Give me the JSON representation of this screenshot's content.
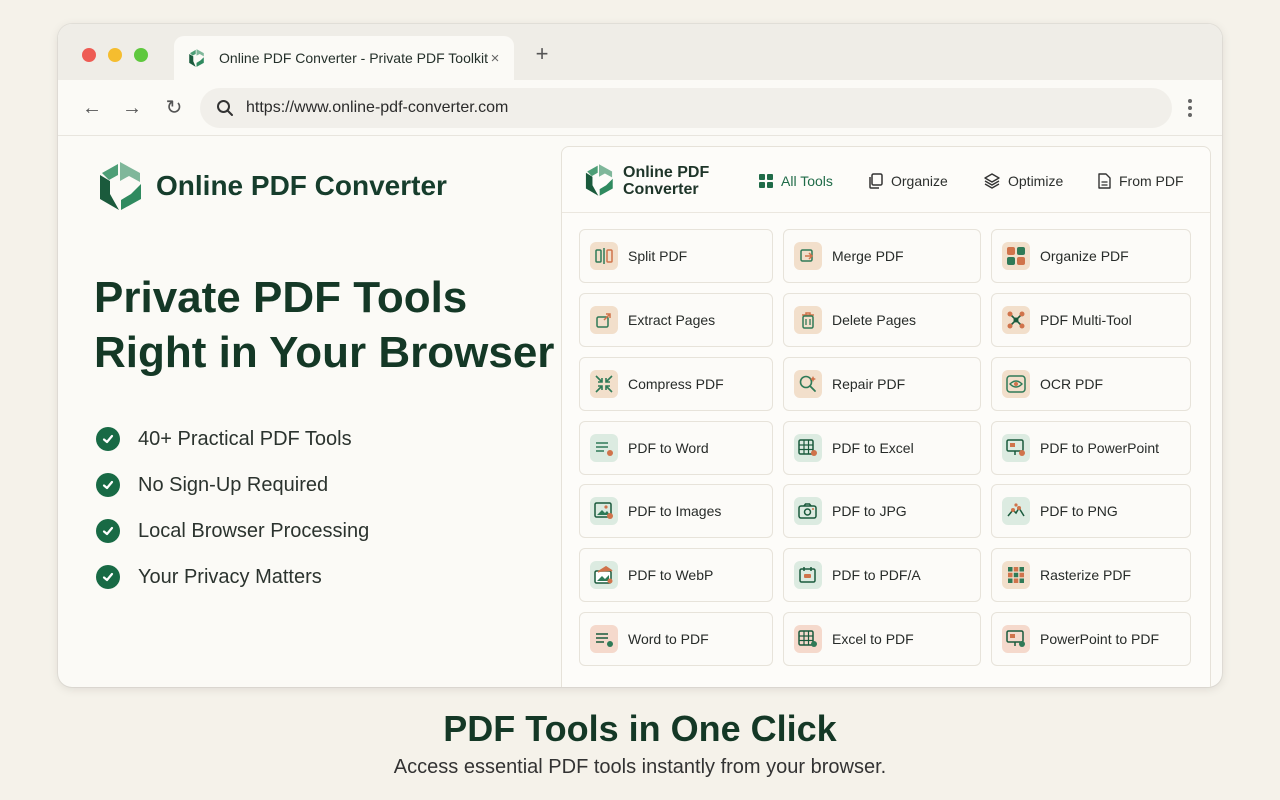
{
  "browser": {
    "tab_title": "Online PDF Converter - Private PDF Toolkit",
    "tab_close": "×",
    "new_tab": "+",
    "url": "https://www.online-pdf-converter.com",
    "back": "←",
    "forward": "→",
    "reload": "↻"
  },
  "hero": {
    "brand": "Online PDF Converter",
    "title_line1": "Private PDF Tools",
    "title_line2": "Right in Your Browser",
    "features": [
      "40+ Practical PDF Tools",
      "No Sign-Up Required",
      "Local Browser Processing",
      "Your Privacy Matters"
    ]
  },
  "panel": {
    "brand_line1": "Online PDF",
    "brand_line2": "Converter",
    "nav": [
      "All Tools",
      "Organize",
      "Optimize",
      "From PDF"
    ],
    "tools": [
      {
        "label": "Split PDF",
        "icon": "split-icon"
      },
      {
        "label": "Merge PDF",
        "icon": "merge-icon"
      },
      {
        "label": "Organize PDF",
        "icon": "organize-icon"
      },
      {
        "label": "Extract Pages",
        "icon": "extract-icon"
      },
      {
        "label": "Delete Pages",
        "icon": "trash-icon"
      },
      {
        "label": "PDF Multi-Tool",
        "icon": "multi-tool-icon"
      },
      {
        "label": "Compress PDF",
        "icon": "compress-icon"
      },
      {
        "label": "Repair PDF",
        "icon": "repair-icon"
      },
      {
        "label": "OCR PDF",
        "icon": "ocr-icon"
      },
      {
        "label": "PDF to Word",
        "icon": "word-icon"
      },
      {
        "label": "PDF to Excel",
        "icon": "excel-icon"
      },
      {
        "label": "PDF to PowerPoint",
        "icon": "powerpoint-icon"
      },
      {
        "label": "PDF to Images",
        "icon": "image-icon"
      },
      {
        "label": "PDF to JPG",
        "icon": "camera-icon"
      },
      {
        "label": "PDF to PNG",
        "icon": "png-icon"
      },
      {
        "label": "PDF to WebP",
        "icon": "webp-icon"
      },
      {
        "label": "PDF to PDF/A",
        "icon": "pdfa-icon"
      },
      {
        "label": "Rasterize PDF",
        "icon": "rasterize-icon"
      },
      {
        "label": "Word to PDF",
        "icon": "word-icon"
      },
      {
        "label": "Excel to PDF",
        "icon": "excel-icon"
      },
      {
        "label": "PowerPoint to PDF",
        "icon": "powerpoint-icon"
      }
    ]
  },
  "footer": {
    "title": "PDF Tools in One Click",
    "subtitle": "Access essential PDF tools instantly from your browser."
  },
  "colors": {
    "brand_dark": "#143826",
    "brand_green": "#186a45",
    "accent_peach": "#f2d9c4",
    "accent_mint": "#dcebe1"
  }
}
